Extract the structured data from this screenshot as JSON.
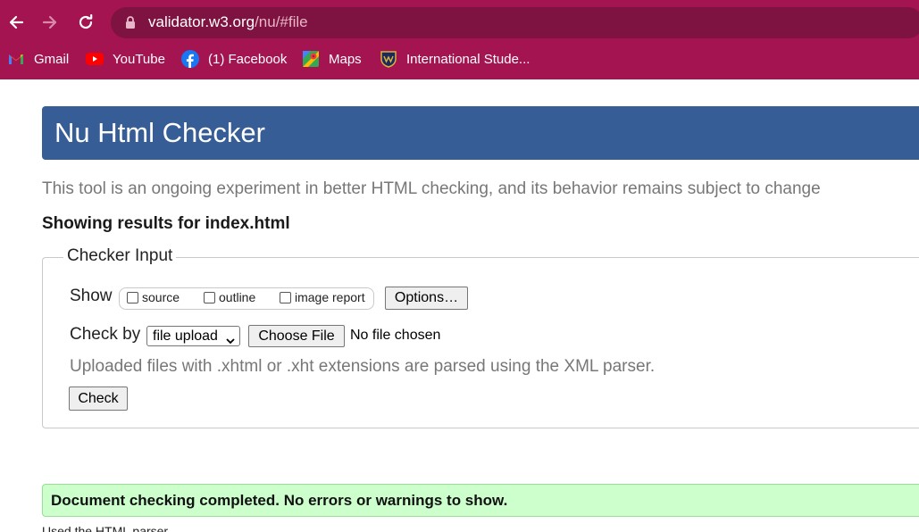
{
  "browser": {
    "url_host": "validator.w3.org",
    "url_path": "/nu/#file",
    "bookmarks": [
      {
        "label": "Gmail",
        "icon": "gmail-icon"
      },
      {
        "label": "YouTube",
        "icon": "youtube-icon"
      },
      {
        "label": "(1) Facebook",
        "icon": "facebook-icon"
      },
      {
        "label": "Maps",
        "icon": "maps-icon"
      },
      {
        "label": "International Stude...",
        "icon": "shield-icon"
      }
    ],
    "colors": {
      "chrome": "#a31451",
      "address_bar": "#7e1240"
    }
  },
  "page": {
    "title": "Nu Html Checker",
    "subtitle": "This tool is an ongoing experiment in better HTML checking, and its behavior remains subject to change",
    "results_heading": "Showing results for index.html",
    "checker_input": {
      "legend": "Checker Input",
      "show_label": "Show",
      "show_options": [
        {
          "label": "source",
          "checked": false
        },
        {
          "label": "outline",
          "checked": false
        },
        {
          "label": "image report",
          "checked": false
        }
      ],
      "options_button": "Options…",
      "check_by_label": "Check by",
      "check_by_selected": "file upload",
      "choose_file_button": "Choose File",
      "file_status": "No file chosen",
      "hint": "Uploaded files with .xhtml or .xht extensions are parsed using the XML parser.",
      "check_button": "Check"
    },
    "result_message": "Document checking completed. No errors or warnings to show.",
    "parser_note": "Used the HTML parser.",
    "colors": {
      "header": "#365d95",
      "success_bg": "#ccffcc"
    }
  }
}
